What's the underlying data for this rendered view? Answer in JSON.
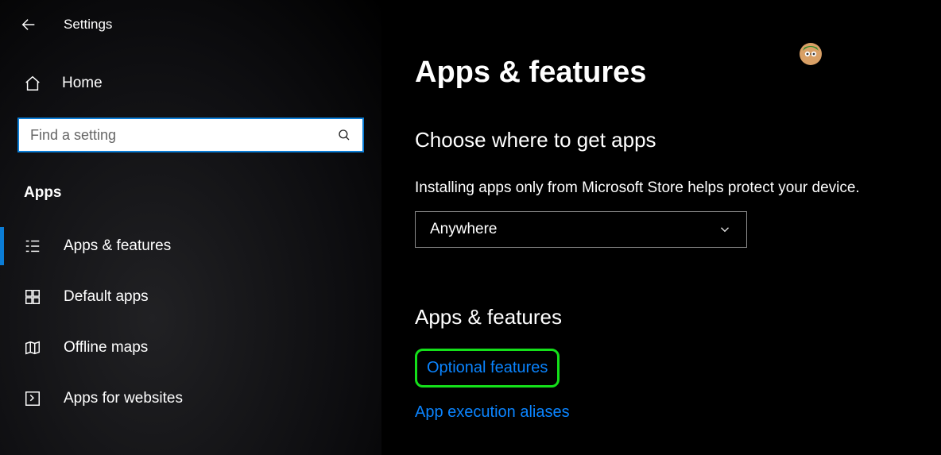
{
  "app_title": "Settings",
  "sidebar": {
    "home_label": "Home",
    "search_placeholder": "Find a setting",
    "group_label": "Apps",
    "items": [
      {
        "label": "Apps & features",
        "icon": "apps-features-icon",
        "active": true
      },
      {
        "label": "Default apps",
        "icon": "default-apps-icon",
        "active": false
      },
      {
        "label": "Offline maps",
        "icon": "offline-maps-icon",
        "active": false
      },
      {
        "label": "Apps for websites",
        "icon": "apps-websites-icon",
        "active": false
      }
    ]
  },
  "main": {
    "page_title": "Apps & features",
    "section1": {
      "title": "Choose where to get apps",
      "helper": "Installing apps only from Microsoft Store helps protect your device.",
      "dropdown_value": "Anywhere"
    },
    "section2": {
      "title": "Apps & features",
      "link1": "Optional features",
      "link2": "App execution aliases"
    }
  }
}
